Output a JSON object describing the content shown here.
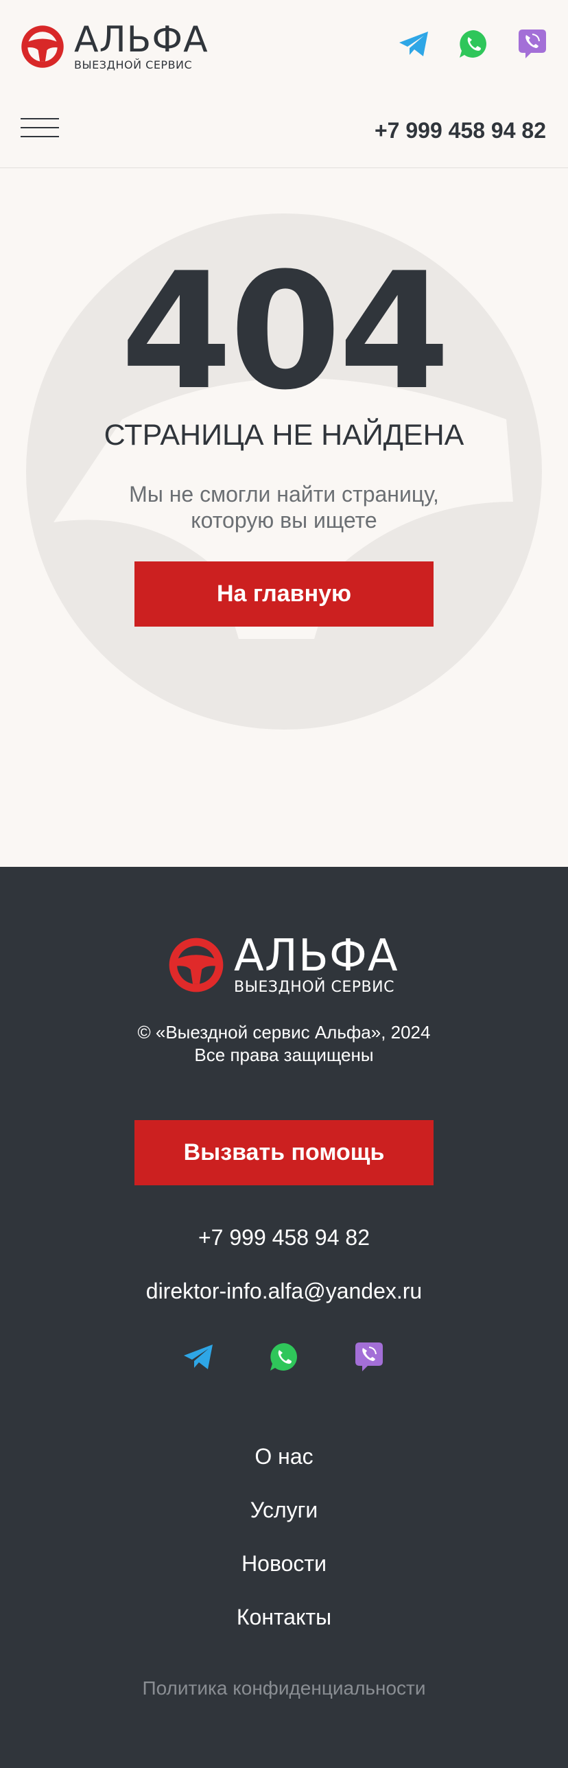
{
  "header": {
    "logo_name": "АЛЬФА",
    "logo_subtitle": "ВЫЕЗДНОЙ СЕРВИС",
    "phone": "+7 999 458 94 82",
    "socials": [
      "telegram-icon",
      "whatsapp-icon",
      "viber-icon"
    ]
  },
  "error": {
    "code": "404",
    "title": "СТРАНИЦА НЕ НАЙДЕНА",
    "message_line1": "Мы не смогли найти страницу,",
    "message_line2": "которую вы ищете",
    "button": "На главную"
  },
  "footer": {
    "logo_name": "АЛЬФА",
    "logo_subtitle": "ВЫЕЗДНОЙ СЕРВИС",
    "copyright_line1": "© «Выездной сервис Альфа», 2024",
    "copyright_line2": "Все права защищены",
    "help_button": "Вызвать помощь",
    "phone": "+7 999 458 94 82",
    "email": "direktor-info.alfa@yandex.ru",
    "nav": [
      "О нас",
      "Услуги",
      "Новости",
      "Контакты"
    ],
    "privacy": "Политика конфиденциальности"
  },
  "colors": {
    "accent": "#cc2020",
    "dark": "#30353b",
    "background": "#faf7f4",
    "telegram": "#2ea6e6",
    "whatsapp": "#2fc65a",
    "viber": "#7d5ad1"
  }
}
